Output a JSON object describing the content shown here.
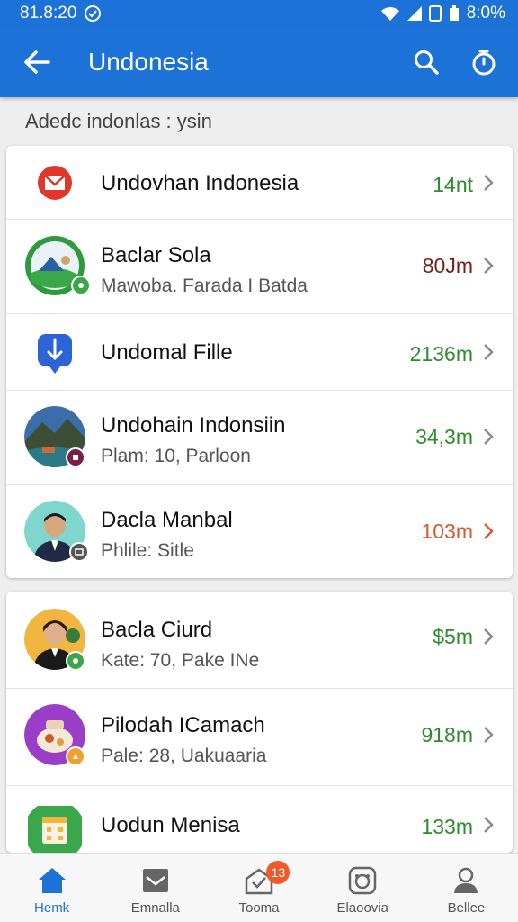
{
  "status": {
    "time": "81.8:20",
    "battery": "8:0%"
  },
  "appbar": {
    "title": "Undonesia"
  },
  "subheader": "Adedc indonlas : ysin",
  "colors": {
    "primary": "#1c72d6",
    "green": "#2e8b2e",
    "red": "#e0542c",
    "darkred": "#7a1d1d"
  },
  "list_one": [
    {
      "title": "Undovhan Indonesia",
      "subtitle": "",
      "value": "14nt",
      "icon": "mail-icon",
      "value_color": "#2e8b2e"
    },
    {
      "title": "Baclar Sola",
      "subtitle": "Mawoba. Farada I Batda",
      "value": "80Jm",
      "icon": "landscape-avatar",
      "value_color": "#7a1d1d"
    },
    {
      "title": "Undomal Fille",
      "subtitle": "",
      "value": "2136m",
      "icon": "download-icon",
      "value_color": "#2e8b2e"
    },
    {
      "title": "Undohain Indonsiin",
      "subtitle": "Plam: 10, Parloon",
      "value": "34,3m",
      "icon": "mountain-avatar",
      "value_color": "#2e8b2e"
    },
    {
      "title": "Dacla Manbal",
      "subtitle": "Phlile: Sitle",
      "value": "103m",
      "icon": "person-avatar",
      "value_color": "#e0542c"
    }
  ],
  "list_two": [
    {
      "title": "Bacla Ciurd",
      "subtitle": "Kate: 70, Pake INe",
      "value": "$5m",
      "icon": "person-avatar",
      "value_color": "#2e8b2e"
    },
    {
      "title": "Pilodah ICamach",
      "subtitle": "Pale: 28, Uakuaaria",
      "value": "918m",
      "icon": "food-avatar",
      "value_color": "#2e8b2e"
    },
    {
      "title": "Uodun Menisa",
      "subtitle": "",
      "value": "133m",
      "icon": "calendar-icon",
      "value_color": "#2e8b2e"
    }
  ],
  "nav": [
    {
      "label": "Hemk",
      "icon": "home-icon",
      "active": true
    },
    {
      "label": "Emnalla",
      "icon": "mail-icon",
      "active": false
    },
    {
      "label": "Tooma",
      "icon": "inbox-icon",
      "active": false,
      "badge": "13"
    },
    {
      "label": "Elaoovia",
      "icon": "camera-icon",
      "active": false
    },
    {
      "label": "Bellee",
      "icon": "profile-icon",
      "active": false
    }
  ]
}
